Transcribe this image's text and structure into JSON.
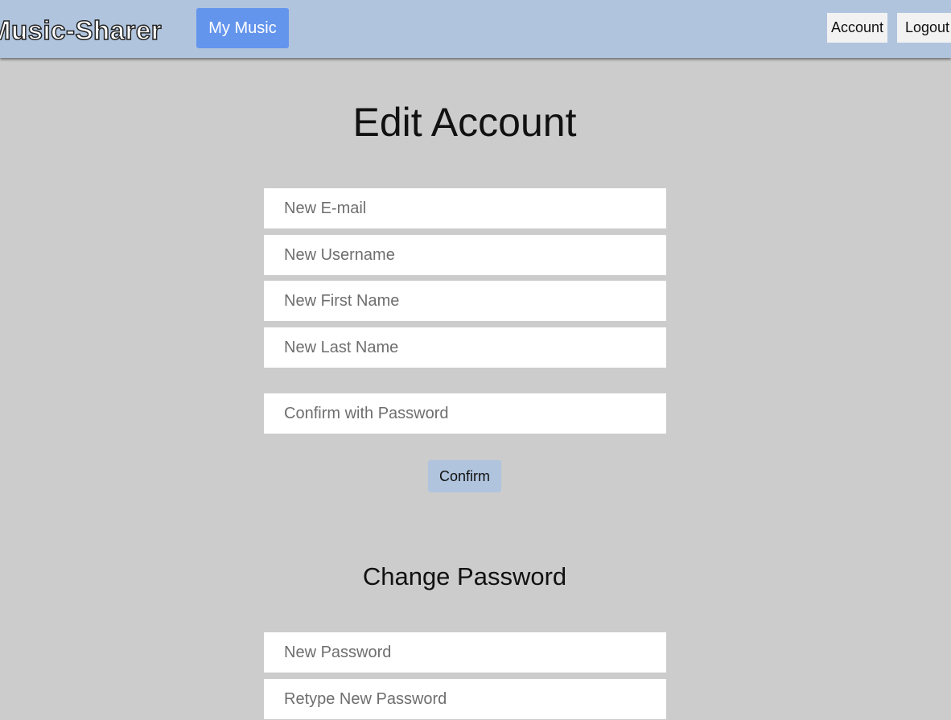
{
  "header": {
    "brand": "Music-Sharer",
    "my_music_label": "My Music",
    "account_label": "Account",
    "logout_label": "Logout"
  },
  "edit_account": {
    "title": "Edit Account",
    "fields": {
      "email_placeholder": "New E-mail",
      "username_placeholder": "New Username",
      "first_name_placeholder": "New First Name",
      "last_name_placeholder": "New Last Name",
      "confirm_password_placeholder": "Confirm with Password"
    },
    "confirm_label": "Confirm"
  },
  "change_password": {
    "title": "Change Password",
    "fields": {
      "new_password_placeholder": "New Password",
      "retype_password_placeholder": "Retype New Password"
    }
  },
  "colors": {
    "header_bg": "#b0c4de",
    "page_bg": "#cccccc",
    "accent": "#6495ed"
  }
}
